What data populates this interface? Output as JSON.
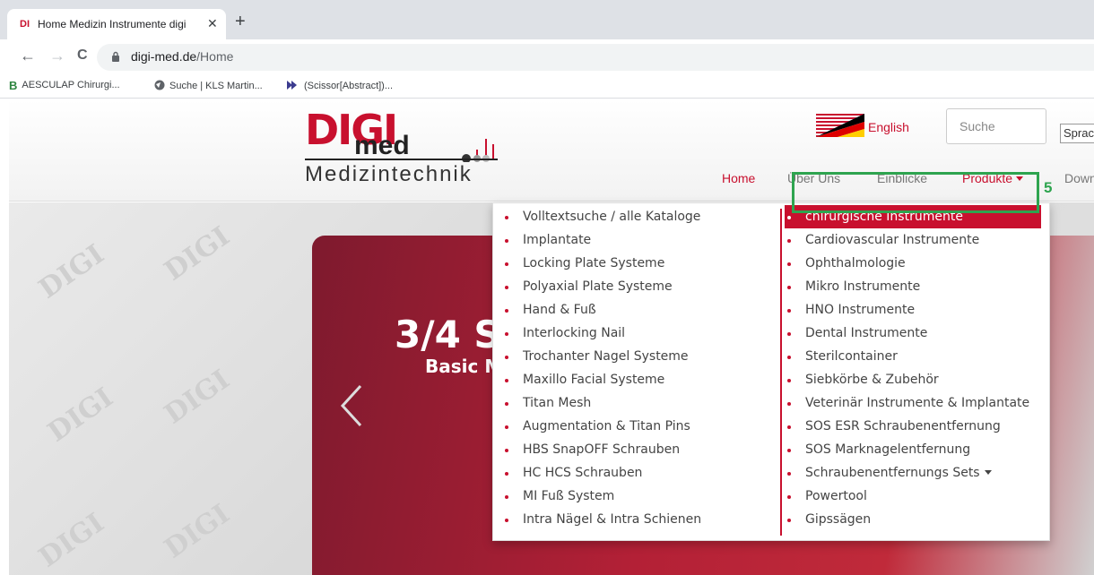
{
  "browser": {
    "tab_title": "Home Medizin Instrumente digi",
    "tab_favicon_text": "DI",
    "new_tab": "+",
    "close": "✕",
    "back": "←",
    "forward": "→",
    "reload": "C",
    "url_host": "digi-med.de",
    "url_path": "/Home"
  },
  "bookmarks": [
    {
      "label": "AESCULAP Chirurgi...",
      "icon": "b-braun-icon",
      "color": "#2e8540"
    },
    {
      "label": "Suche | KLS Martin...",
      "icon": "globe-icon",
      "color": "#555555"
    },
    {
      "label": "(Scissor[Abstract])...",
      "icon": "play-icon",
      "color": "#3b3b8f"
    }
  ],
  "site": {
    "logo_digi": "DIGI",
    "logo_med": "med",
    "logo_sub": "Medizintechnik",
    "language": "English",
    "search_placeholder": "Suche",
    "sprache": "Sprache",
    "menu": [
      "Home",
      "Über Uns",
      "Einblicke",
      "Produkte",
      "Downloads"
    ],
    "active_menu": "Home",
    "open_menu": "Produkte",
    "slide_title": "3/4 S",
    "slide_sub": "Basic M",
    "accent_color": "#c8102e"
  },
  "dropdown": {
    "column1": [
      "Volltextsuche / alle Kataloge",
      "Implantate",
      "Locking Plate Systeme",
      "Polyaxial Plate Systeme",
      "Hand & Fuß",
      "Interlocking Nail",
      "Trochanter Nagel Systeme",
      "Maxillo Facial Systeme",
      "Titan Mesh",
      "Augmentation & Titan Pins",
      "HBS SnapOFF Schrauben",
      "HC HCS Schrauben",
      "MI Fuß System",
      "Intra Nägel & Intra Schienen"
    ],
    "column2": [
      "chirurgische Instrumente",
      "Cardiovascular Instrumente",
      "Ophthalmologie",
      "Mikro Instrumente",
      "HNO Instrumente",
      "Dental Instrumente",
      "Sterilcontainer",
      "Siebkörbe & Zubehör",
      "Veterinär Instrumente & Implantate",
      "SOS ESR Schraubenentfernung",
      "SOS Marknagelentfernung",
      "Schraubenentfernungs Sets",
      "Powertool",
      "Gipssägen"
    ],
    "highlighted": "chirurgische Instrumente"
  },
  "annotation": {
    "number": "5",
    "color": "#2ea44f"
  }
}
